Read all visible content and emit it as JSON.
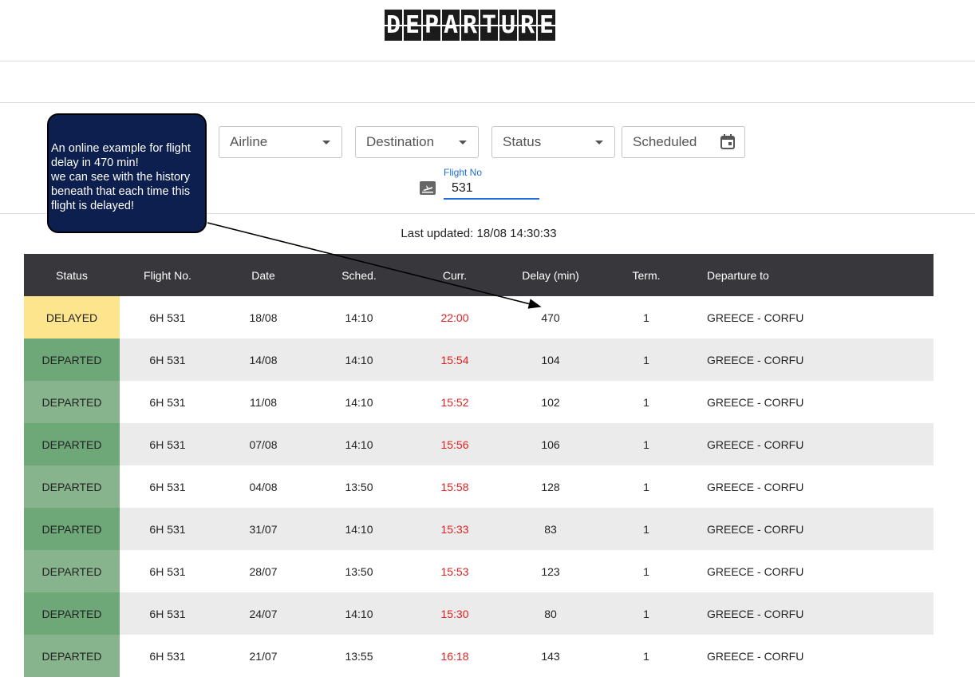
{
  "header": {
    "logo_letters": [
      "D",
      "E",
      "P",
      "A",
      "R",
      "T",
      "U",
      "R",
      "E"
    ]
  },
  "callout": {
    "lines": [
      "An online example for flight delay in 470 min!",
      "we can see with the history beneath that each time this flight is delayed!"
    ]
  },
  "filters": {
    "airline": "Airline",
    "destination": "Destination",
    "status": "Status",
    "scheduled": "Scheduled"
  },
  "flight_search": {
    "label": "Flight No",
    "value": "531"
  },
  "last_updated": "Last updated: 18/08 14:30:33",
  "table": {
    "headers": [
      "Status",
      "Flight No.",
      "Date",
      "Sched.",
      "Curr.",
      "Delay (min)",
      "Term.",
      "Departure to"
    ],
    "rows": [
      {
        "status": "DELAYED",
        "flight": "6H 531",
        "date": "18/08",
        "sched": "14:10",
        "curr": "22:00",
        "delay": "470",
        "term": "1",
        "dest": "GREECE - CORFU"
      },
      {
        "status": "DEPARTED",
        "flight": "6H 531",
        "date": "14/08",
        "sched": "14:10",
        "curr": "15:54",
        "delay": "104",
        "term": "1",
        "dest": "GREECE - CORFU"
      },
      {
        "status": "DEPARTED",
        "flight": "6H 531",
        "date": "11/08",
        "sched": "14:10",
        "curr": "15:52",
        "delay": "102",
        "term": "1",
        "dest": "GREECE - CORFU"
      },
      {
        "status": "DEPARTED",
        "flight": "6H 531",
        "date": "07/08",
        "sched": "14:10",
        "curr": "15:56",
        "delay": "106",
        "term": "1",
        "dest": "GREECE - CORFU"
      },
      {
        "status": "DEPARTED",
        "flight": "6H 531",
        "date": "04/08",
        "sched": "13:50",
        "curr": "15:58",
        "delay": "128",
        "term": "1",
        "dest": "GREECE - CORFU"
      },
      {
        "status": "DEPARTED",
        "flight": "6H 531",
        "date": "31/07",
        "sched": "14:10",
        "curr": "15:33",
        "delay": "83",
        "term": "1",
        "dest": "GREECE - CORFU"
      },
      {
        "status": "DEPARTED",
        "flight": "6H 531",
        "date": "28/07",
        "sched": "13:50",
        "curr": "15:53",
        "delay": "123",
        "term": "1",
        "dest": "GREECE - CORFU"
      },
      {
        "status": "DEPARTED",
        "flight": "6H 531",
        "date": "24/07",
        "sched": "14:10",
        "curr": "15:30",
        "delay": "80",
        "term": "1",
        "dest": "GREECE - CORFU"
      },
      {
        "status": "DEPARTED",
        "flight": "6H 531",
        "date": "21/07",
        "sched": "13:55",
        "curr": "16:18",
        "delay": "143",
        "term": "1",
        "dest": "GREECE - CORFU"
      }
    ]
  },
  "colors": {
    "header_bg": "#38383c",
    "delayed": "#fde58d",
    "departed": "#88b48d",
    "current_time": "#e02020",
    "accent": "#1e6fd6",
    "callout_bg": "#0d1f4f"
  }
}
